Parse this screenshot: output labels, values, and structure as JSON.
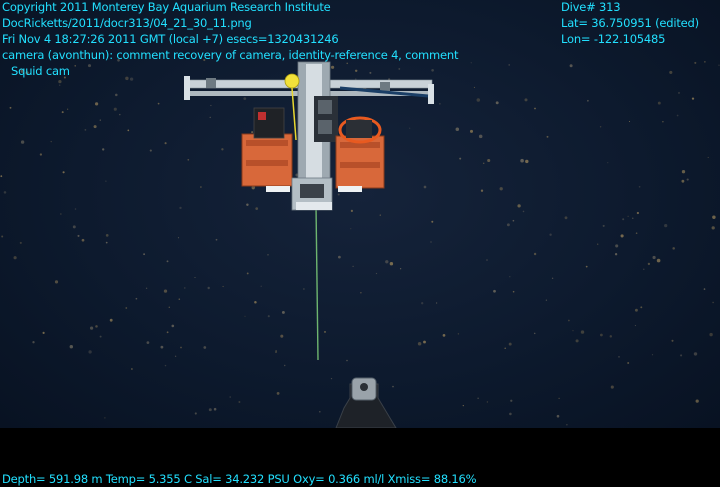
{
  "overlay": {
    "copyright": "Copyright 2011 Monterey Bay Aquarium Research Institute",
    "filename": "DocRicketts/2011/docr313/04_21_30_11.png",
    "datetime": "Fri Nov  4 18:27:26 2011 GMT (local +7)  esecs=1320431246",
    "comment": "camera (avonthun): comment recovery of camera, identity-reference 4, comment",
    "camera_label": "Squid cam",
    "dive": "Dive# 313",
    "lat": "Lat= 36.750951 (edited)",
    "lon": "Lon= -122.105485",
    "sensors": "Depth= 591.98 m  Temp= 5.355 C  Sal= 34.232 PSU  Oxy= 0.366 ml/l  Xmiss= 88.16%"
  },
  "colors": {
    "overlay_text": "#22e0ff",
    "water": "#0d1a2e",
    "frame_orange": "#d8683a",
    "tether_green": "#7fd07a"
  }
}
